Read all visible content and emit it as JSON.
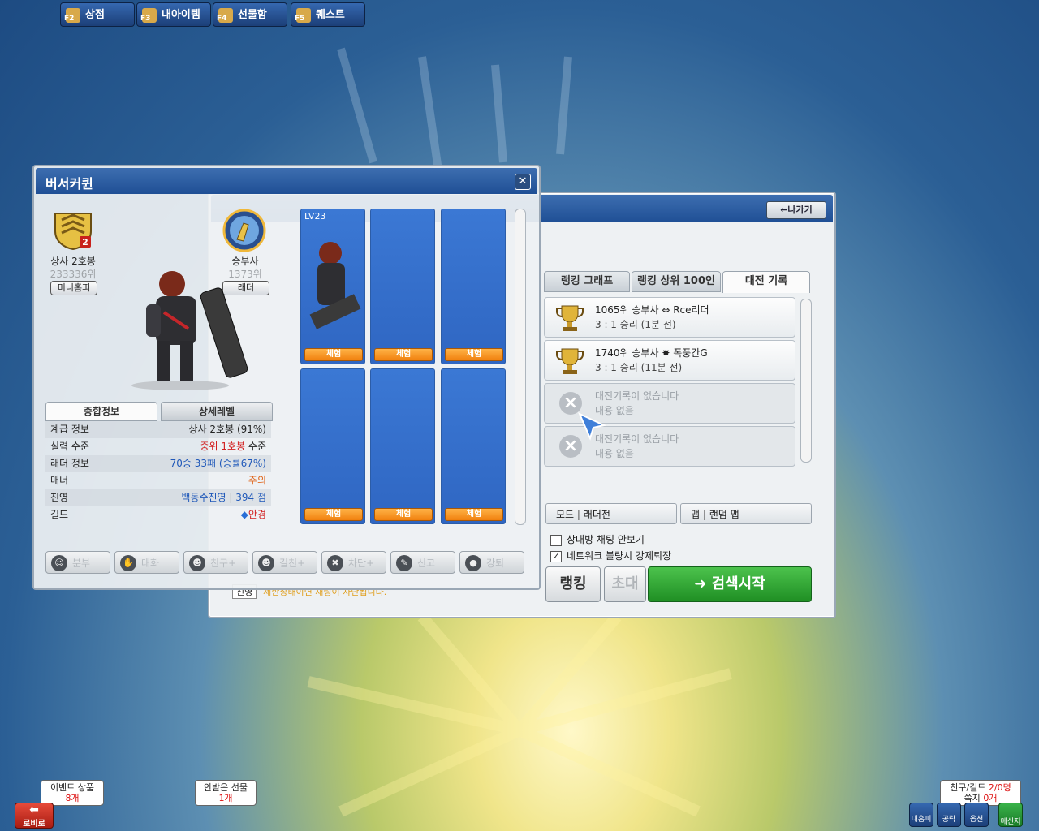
{
  "back_window": {
    "exit_label": "←나가기",
    "tabs": [
      {
        "label": "랭킹 그래프",
        "active": false
      },
      {
        "label": "랭킹 상위 100인",
        "active": false
      },
      {
        "label": "대전 기록",
        "active": true
      }
    ],
    "records": [
      {
        "line1": "1065위 승부사 ⇔ Rce리더",
        "line2": "3 : 1 승리 (1분 전)",
        "empty": false
      },
      {
        "line1": "1740위 승부사 ✸ 폭풍간G",
        "line2": "3 : 1 승리 (11분 전)",
        "empty": false
      },
      {
        "line1": "대전기록이 없습니다",
        "line2": "내용 없음",
        "empty": true
      },
      {
        "line1": "대전기록이 없습니다",
        "line2": "내용 없음",
        "empty": true
      }
    ],
    "mode_label": "모드",
    "mode_value": "래더전",
    "map_label": "맵",
    "map_value": "랜덤 맵",
    "opt_hide_chat": "상대방 채팅 안보기",
    "opt_hide_chat_checked": false,
    "opt_force_exit": "네트워크 불량시 강제퇴장",
    "opt_force_exit_checked": true,
    "btn_ranking": "랭킹",
    "btn_invite": "초대",
    "btn_search": "➜ 검색시작",
    "bottom_select": "진영",
    "bottom_note": "제한상태이면 채팅이 차단됩니다."
  },
  "front_window": {
    "title": "버서커퀸",
    "rank_name": "상사 2호봉",
    "rank_position": "233336위",
    "minihompy_btn": "미니홈피",
    "job_name": "승부사",
    "job_rank": "1373위",
    "ladder_btn": "래더",
    "info_tabs": [
      {
        "label": "종합정보",
        "active": true
      },
      {
        "label": "상세레벨",
        "active": false
      }
    ],
    "info_rows": [
      {
        "key": "계급 정보",
        "value": "상사 2호봉 (91%)",
        "color": "#222222"
      },
      {
        "key": "실력 수준",
        "value_parts": [
          "중위 1호봉",
          " 수준"
        ],
        "color": "#d21f1f"
      },
      {
        "key": "래더 정보",
        "value": "70승 33패 (승률67%)",
        "color": "#1f58b9"
      },
      {
        "key": "매너",
        "value": "주의",
        "color": "#e0651a"
      },
      {
        "key": "진영",
        "value_parts": [
          "백동수진영",
          " | ",
          "394 점"
        ],
        "color": "#1f58b9"
      },
      {
        "key": "길드",
        "value": "안경",
        "color": "#d21f1f"
      }
    ],
    "slots": [
      {
        "level": "LV23",
        "button": "체험",
        "has_char": true
      },
      {
        "level": "",
        "button": "체험",
        "has_char": false
      },
      {
        "level": "",
        "button": "체험",
        "has_char": false
      },
      {
        "level": "",
        "button": "체험",
        "has_char": false
      },
      {
        "level": "",
        "button": "체험",
        "has_char": false
      },
      {
        "level": "",
        "button": "체험",
        "has_char": false
      }
    ],
    "actions": [
      "분부",
      "대화",
      "친구+",
      "길친+",
      "차단+",
      "신고",
      "강퇴"
    ]
  },
  "taskbar": {
    "lobby_label": "로비로",
    "buttons": [
      {
        "fkey": "F2",
        "label": "상점"
      },
      {
        "fkey": "F3",
        "label": "내아이템"
      },
      {
        "fkey": "F4",
        "label": "선물함"
      },
      {
        "fkey": "F5",
        "label": "퀘스트"
      }
    ],
    "bubble_event": {
      "line1": "이벤트 상품",
      "line2": "8개"
    },
    "bubble_gift": {
      "line1": "안받은 선물",
      "line2": "1개"
    },
    "bubble_friends": {
      "line1": "친구/길드",
      "count1": "2/0명",
      "line2": "쪽지",
      "count2": "0개"
    },
    "right_icons": [
      "내홈피",
      "공략",
      "옵션"
    ],
    "messenger": "메신저"
  }
}
